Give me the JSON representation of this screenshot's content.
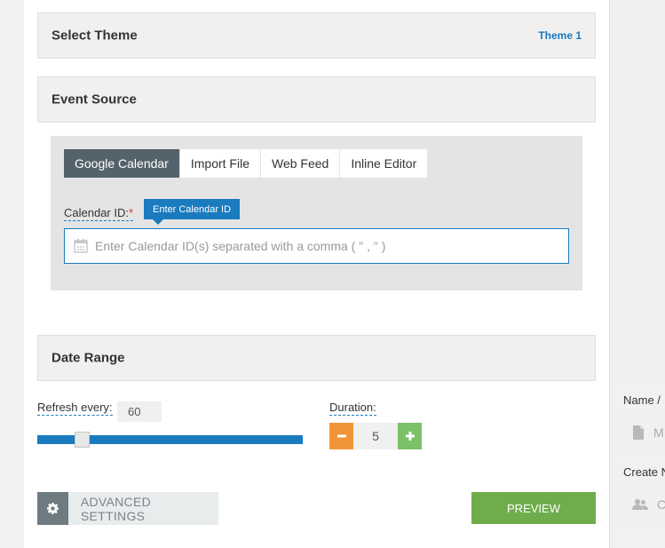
{
  "theme_section": {
    "title": "Select Theme",
    "value": "Theme 1"
  },
  "event_source": {
    "title": "Event Source",
    "tabs": [
      {
        "label": "Google Calendar",
        "active": true
      },
      {
        "label": "Import File",
        "active": false
      },
      {
        "label": "Web Feed",
        "active": false
      },
      {
        "label": "Inline Editor",
        "active": false
      }
    ],
    "calendar_label": "Calendar ID:",
    "required_mark": "*",
    "tooltip": "Enter Calendar ID",
    "calendar_placeholder": "Enter Calendar ID(s) separated with a comma ( \" , \" )",
    "calendar_value": ""
  },
  "date_range": {
    "title": "Date Range",
    "refresh_label": "Refresh every:",
    "refresh_value": "60",
    "slider_fraction": 0.15,
    "duration_label": "Duration:",
    "duration_value": "5"
  },
  "footer": {
    "advanced_label": "ADVANCED SETTINGS",
    "preview_label": "PREVIEW"
  },
  "side": {
    "name_label": "Name /",
    "name_placeholder": "M",
    "create_label": "Create N",
    "create_placeholder": "Cr"
  },
  "colors": {
    "accent": "#1a7bbf",
    "active_tab": "#54636b",
    "minus_button": "#f2953a",
    "plus_button": "#7cc068",
    "preview_button": "#6fad4c",
    "required": "#e0332b"
  }
}
